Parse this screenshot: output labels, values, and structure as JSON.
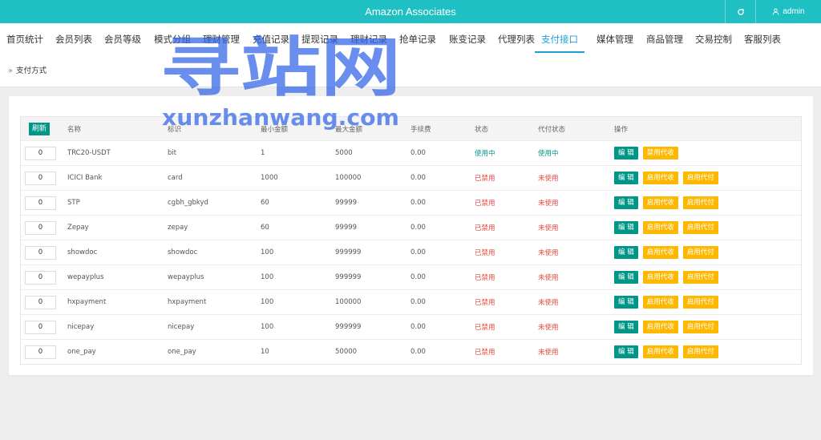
{
  "header": {
    "title": "Amazon Associates",
    "user": "admin"
  },
  "nav": {
    "tabs": [
      {
        "label": "首页统计",
        "active": false
      },
      {
        "label": "会员列表",
        "active": false
      },
      {
        "label": "会员等级",
        "active": false
      },
      {
        "label": "模式分组",
        "active": false
      },
      {
        "label": "理财管理",
        "active": false
      },
      {
        "label": "充值记录",
        "active": false
      },
      {
        "label": "提现记录",
        "active": false
      },
      {
        "label": "理财记录",
        "active": false
      },
      {
        "label": "抢单记录",
        "active": false
      },
      {
        "label": "账变记录",
        "active": false
      },
      {
        "label": "代理列表",
        "active": false
      },
      {
        "label": "支付接口",
        "active": true
      },
      {
        "label": "媒体管理",
        "active": false
      },
      {
        "label": "商品管理",
        "active": false
      },
      {
        "label": "交易控制",
        "active": false
      },
      {
        "label": "客服列表",
        "active": false
      }
    ]
  },
  "breadcrumb": {
    "current": "支付方式"
  },
  "table": {
    "refresh_label": "刷新",
    "columns": [
      "名称",
      "标识",
      "最小金额",
      "最大金额",
      "手续费",
      "状态",
      "代付状态",
      "操作"
    ],
    "rows": [
      {
        "sort": "0",
        "name": "TRC20-USDT",
        "code": "bit",
        "min": "1",
        "max": "5000",
        "fee": "0.00",
        "status": "使用中",
        "status_on": true,
        "payout": "使用中",
        "payout_on": true,
        "actions": [
          "编 辑",
          "禁用代收"
        ]
      },
      {
        "sort": "0",
        "name": "ICICI Bank",
        "code": "card",
        "min": "1000",
        "max": "100000",
        "fee": "0.00",
        "status": "已禁用",
        "status_on": false,
        "payout": "未使用",
        "payout_on": false,
        "actions": [
          "编 辑",
          "启用代收",
          "启用代付"
        ]
      },
      {
        "sort": "0",
        "name": "STP",
        "code": "cgbh_gbkyd",
        "min": "60",
        "max": "99999",
        "fee": "0.00",
        "status": "已禁用",
        "status_on": false,
        "payout": "未使用",
        "payout_on": false,
        "actions": [
          "编 辑",
          "启用代收",
          "启用代付"
        ]
      },
      {
        "sort": "0",
        "name": "Zepay",
        "code": "zepay",
        "min": "60",
        "max": "99999",
        "fee": "0.00",
        "status": "已禁用",
        "status_on": false,
        "payout": "未使用",
        "payout_on": false,
        "actions": [
          "编 辑",
          "启用代收",
          "启用代付"
        ]
      },
      {
        "sort": "0",
        "name": "showdoc",
        "code": "showdoc",
        "min": "100",
        "max": "999999",
        "fee": "0.00",
        "status": "已禁用",
        "status_on": false,
        "payout": "未使用",
        "payout_on": false,
        "actions": [
          "编 辑",
          "启用代收",
          "启用代付"
        ]
      },
      {
        "sort": "0",
        "name": "wepayplus",
        "code": "wepayplus",
        "min": "100",
        "max": "999999",
        "fee": "0.00",
        "status": "已禁用",
        "status_on": false,
        "payout": "未使用",
        "payout_on": false,
        "actions": [
          "编 辑",
          "启用代收",
          "启用代付"
        ]
      },
      {
        "sort": "0",
        "name": "hxpayment",
        "code": "hxpayment",
        "min": "100",
        "max": "100000",
        "fee": "0.00",
        "status": "已禁用",
        "status_on": false,
        "payout": "未使用",
        "payout_on": false,
        "actions": [
          "编 辑",
          "启用代收",
          "启用代付"
        ]
      },
      {
        "sort": "0",
        "name": "nicepay",
        "code": "nicepay",
        "min": "100",
        "max": "999999",
        "fee": "0.00",
        "status": "已禁用",
        "status_on": false,
        "payout": "未使用",
        "payout_on": false,
        "actions": [
          "编 辑",
          "启用代收",
          "启用代付"
        ]
      },
      {
        "sort": "0",
        "name": "one_pay",
        "code": "one_pay",
        "min": "10",
        "max": "50000",
        "fee": "0.00",
        "status": "已禁用",
        "status_on": false,
        "payout": "未使用",
        "payout_on": false,
        "actions": [
          "编 辑",
          "启用代收",
          "启用代付"
        ]
      }
    ]
  },
  "watermark": {
    "cn": "寻站网",
    "en": "xunzhanwang.com"
  },
  "colors": {
    "header_bg": "#1fc0c3",
    "active_tab": "#1d9fd8",
    "primary": "#009688",
    "warn": "#ffb800",
    "danger": "#e8453c",
    "watermark": "#2f63e8"
  },
  "icons": {
    "refresh": "refresh-icon",
    "user": "user-icon",
    "breadcrumb": "double-chevron-icon"
  }
}
